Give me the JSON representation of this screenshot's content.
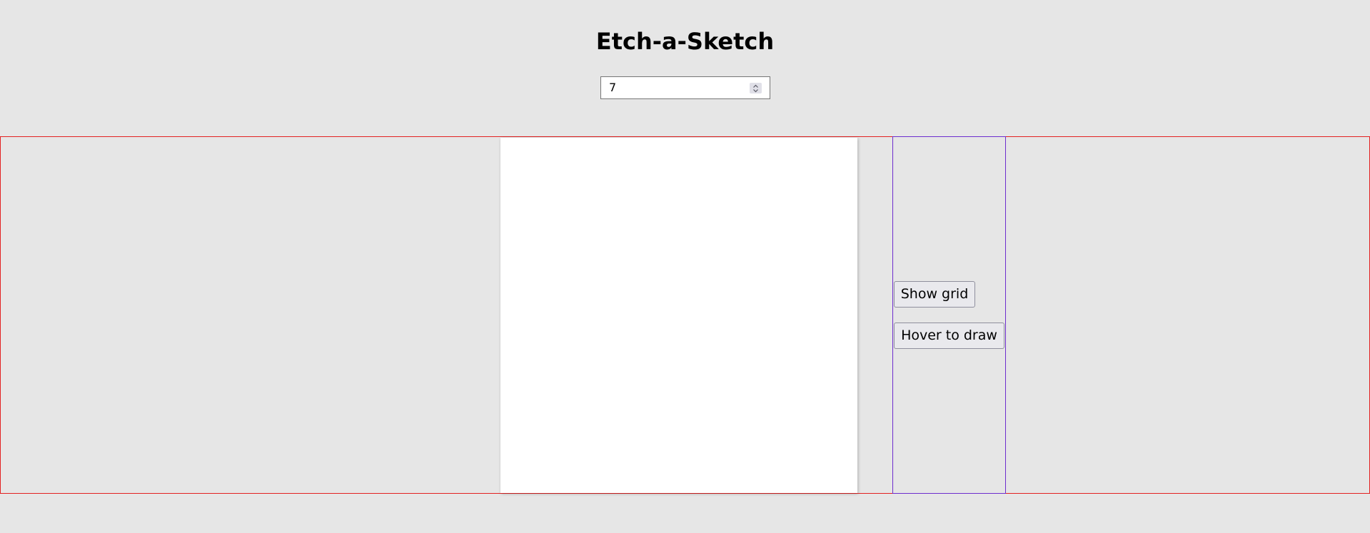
{
  "header": {
    "title": "Etch-a-Sketch"
  },
  "grid_size_input": {
    "value": "7"
  },
  "controls": {
    "show_grid_label": "Show grid",
    "hover_to_draw_label": "Hover to draw"
  },
  "colors": {
    "background": "#e6e6e6",
    "container_border": "#e32222",
    "controls_border": "#6d2dce",
    "board": "#ffffff"
  }
}
